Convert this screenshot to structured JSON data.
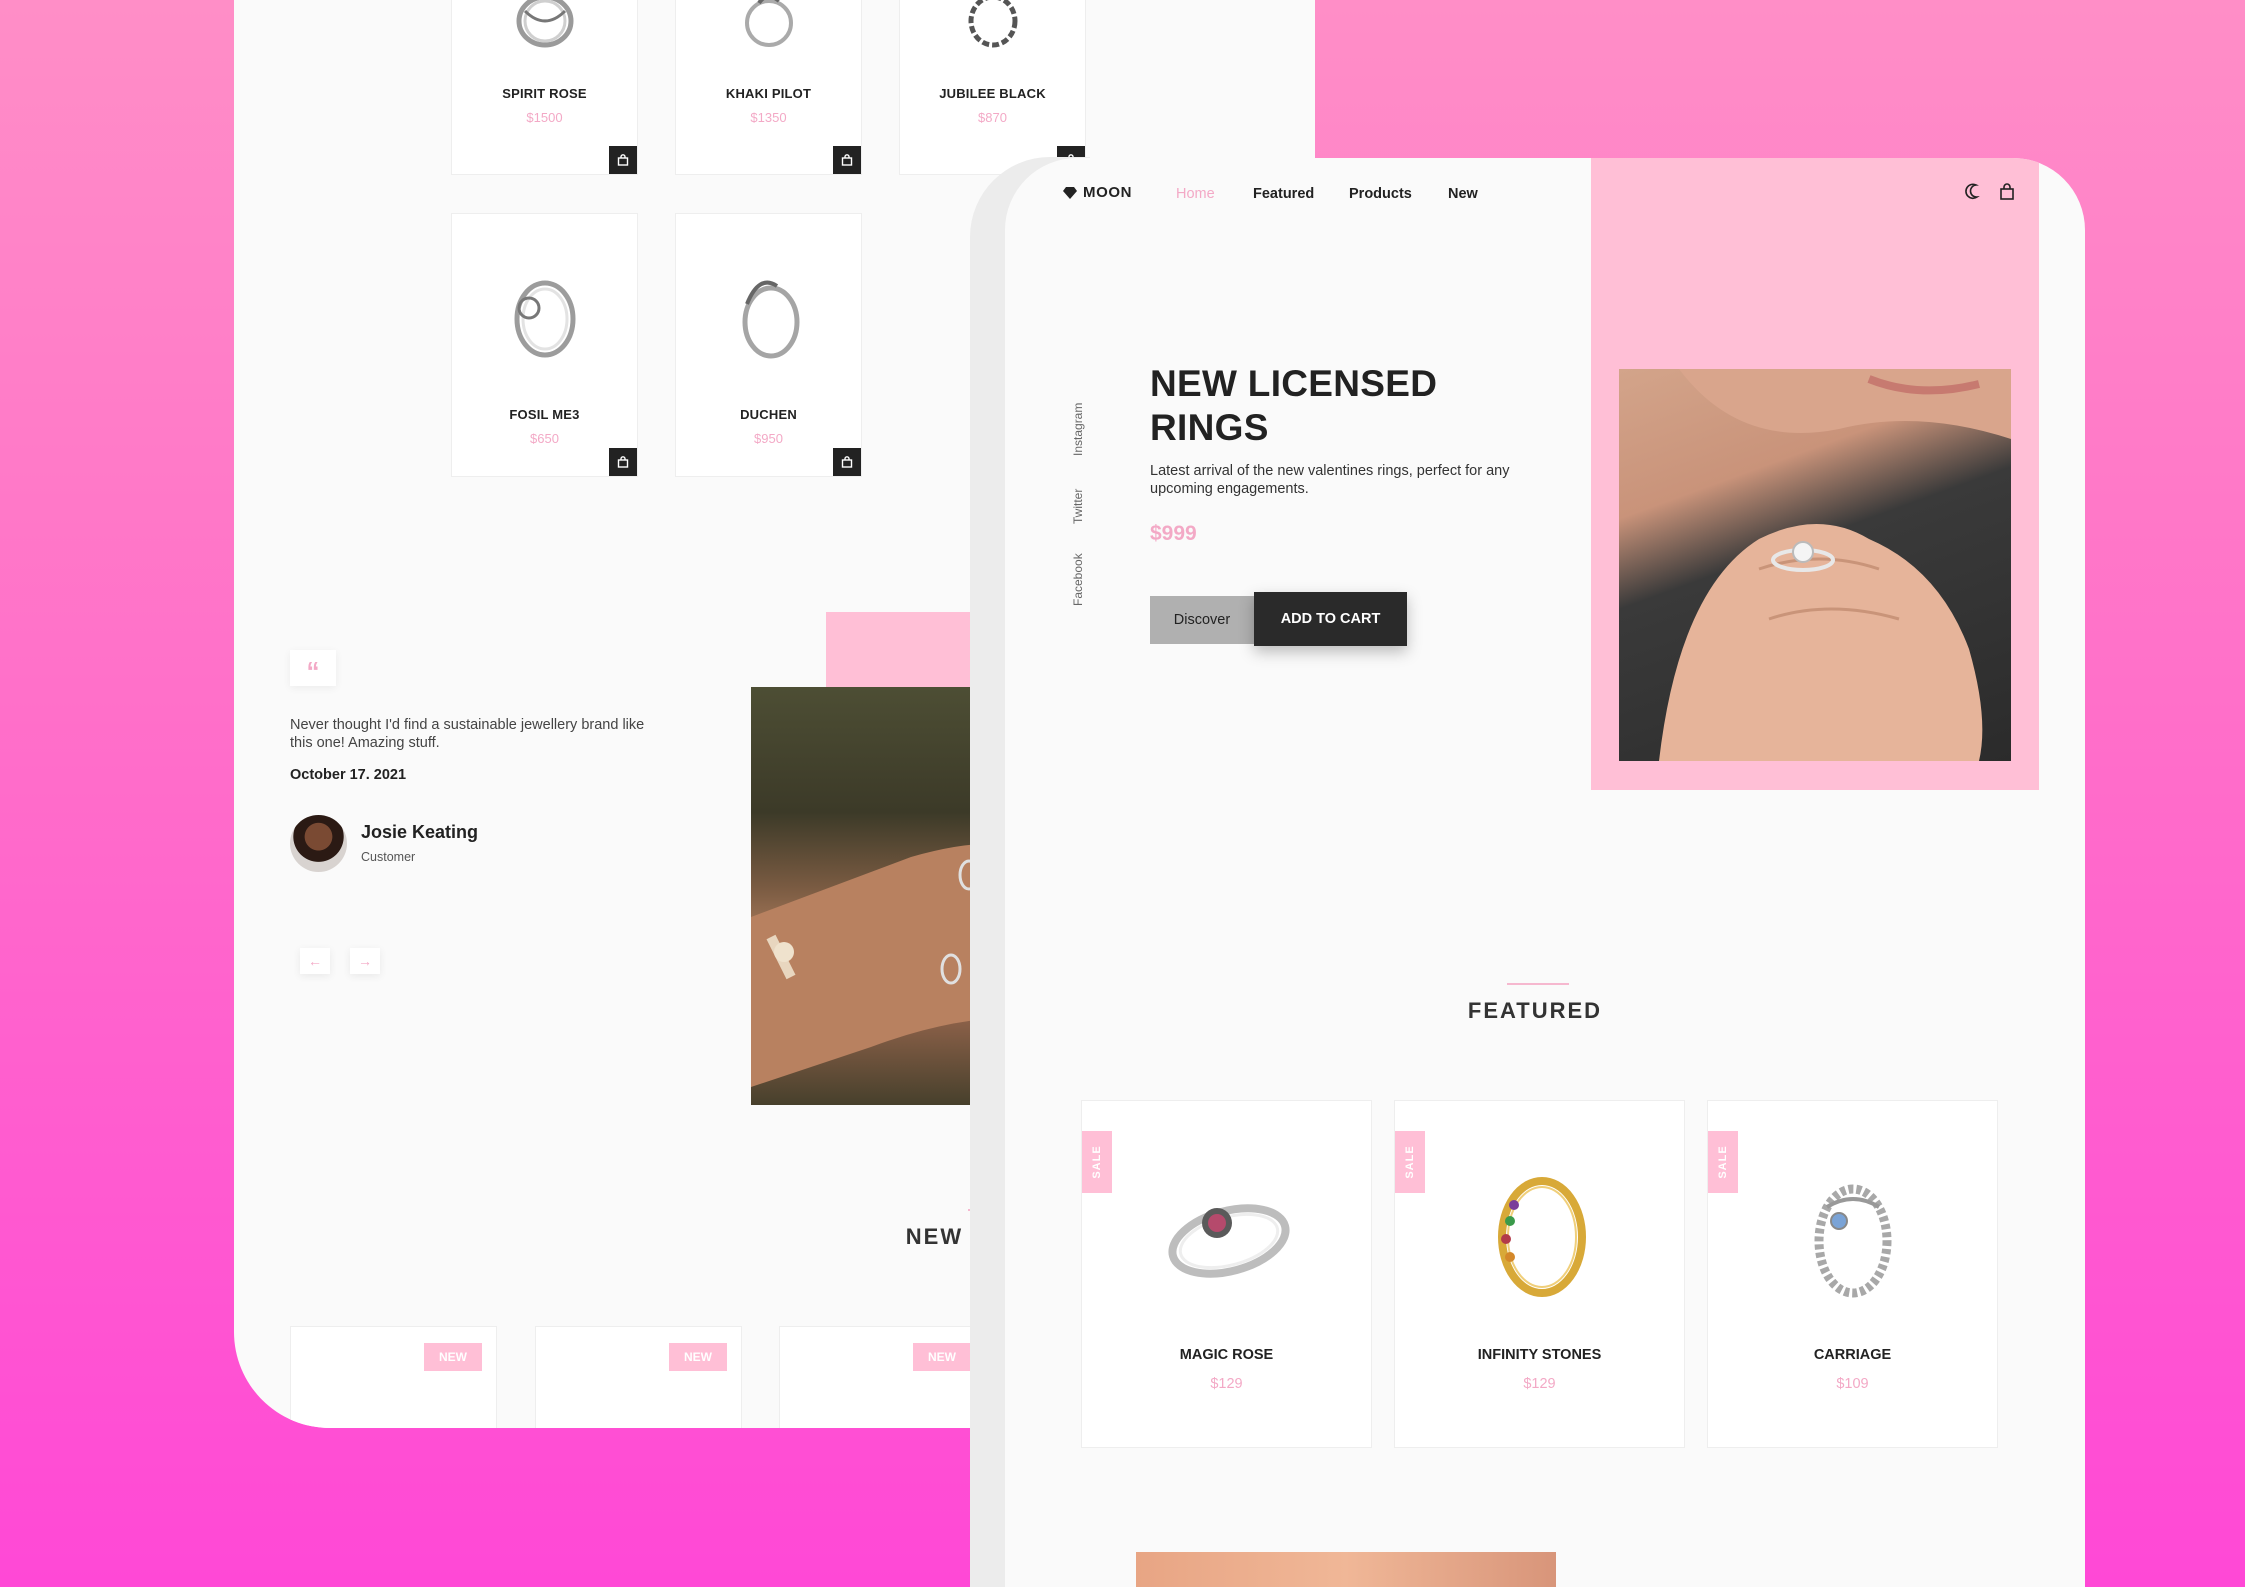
{
  "back": {
    "products": [
      {
        "name": "SPIRIT ROSE",
        "price": "$1500"
      },
      {
        "name": "KHAKI PILOT",
        "price": "$1350"
      },
      {
        "name": "JUBILEE BLACK",
        "price": "$870"
      },
      {
        "name": "FOSIL ME3",
        "price": "$650"
      },
      {
        "name": "DUCHEN",
        "price": "$950"
      }
    ],
    "testimonial": {
      "quote_icon": "“",
      "text": "Never thought I'd find a sustainable jewellery brand like this one! Amazing stuff.",
      "date": "October 17. 2021",
      "name": "Josie Keating",
      "role": "Customer",
      "prev": "←",
      "next": "→"
    },
    "new_arrivals": {
      "title": "NEW ARRIVALS",
      "badges": [
        "NEW",
        "NEW",
        "NEW"
      ]
    }
  },
  "front": {
    "nav": {
      "logo": "MOON",
      "links": [
        "Home",
        "Featured",
        "Products",
        "New"
      ]
    },
    "social": [
      "Instagram",
      "Twitter",
      "Facebook"
    ],
    "hero": {
      "title": "NEW LICENSED RINGS",
      "description": "Latest arrival of the new valentines rings, perfect for any upcoming engagements.",
      "price": "$999",
      "discover": "Discover",
      "add_to_cart": "ADD TO CART"
    },
    "featured": {
      "title": "FEATURED",
      "items": [
        {
          "badge": "SALE",
          "name": "MAGIC ROSE",
          "price": "$129"
        },
        {
          "badge": "SALE",
          "name": "INFINITY STONES",
          "price": "$129"
        },
        {
          "badge": "SALE",
          "name": "CARRIAGE",
          "price": "$109"
        }
      ]
    }
  },
  "colors": {
    "accent_pink": "#f3a9c6",
    "pink_block": "#ffbfd6",
    "dark": "#222222",
    "background_gradient": [
      "#ff8ec7",
      "#ff48d6"
    ]
  },
  "icons": [
    "diamond-icon",
    "moon-icon",
    "shopping-bag-icon",
    "quote-icon",
    "arrow-left-icon",
    "arrow-right-icon"
  ]
}
